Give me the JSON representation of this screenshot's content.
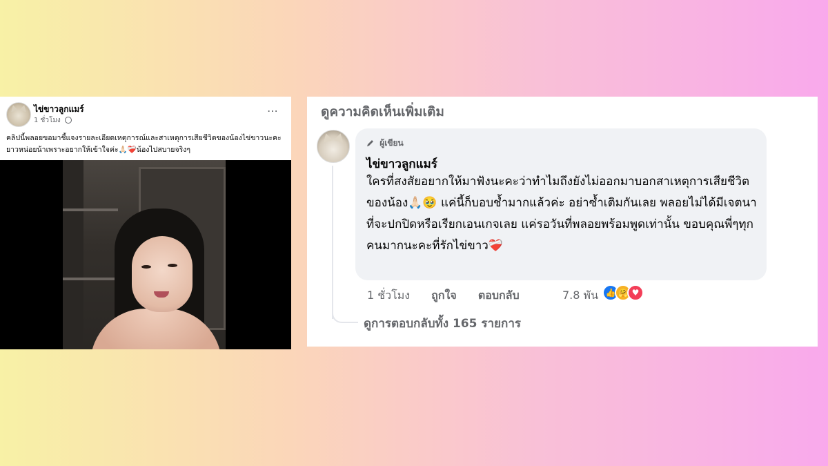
{
  "post": {
    "author": "ไข่ขาวลูกแมร์",
    "time": "1 ชั่วโมง",
    "more_icon": "⋯",
    "caption": "คลิปนี้พลอยขอมาชี้แจงรายละเอียดเหตุการณ์และสาเหตุการเสียชีวิตของน้องไข่ขาวนะคะ ยาวหน่อยน้าเพราะอยากให้เข้าใจค่ะ🙏🏻❤️‍🩹น้องไปสบายจริงๆ"
  },
  "comments": {
    "more_comments_label": "ดูความคิดเห็นเพิ่มเติม",
    "comment": {
      "badge": "ผู้เขียน",
      "author": "ไข่ขาวลูกแมร์",
      "text": "ใครที่สงสัยอยากให้มาฟังนะคะว่าทำไมถึงยังไม่ออกมาบอกสาเหตุการเสียชีวิตของน้อง🙏🏻🥹 แค่นี้ก็บอบช้ำมากแล้วค่ะ อย่าซ้ำเติมกันเลย พลอยไม่ได้มีเจตนาที่จะปกปิดหรือเรียกเอนเกจเลย แค่รอวันที่พลอยพร้อมพูดเท่านั้น ขอบคุณพี่ๆทุกคนมากนะคะที่รักไข่ขาว❤️‍🩹",
      "time": "1 ชั่วโมง",
      "like_label": "ถูกใจ",
      "reply_label": "ตอบกลับ",
      "reaction_count": "7.8 พัน",
      "reactions": [
        "like-icon",
        "care-icon",
        "love-icon"
      ]
    },
    "view_replies_label": "ดูการตอบกลับทั้ง 165 รายการ"
  },
  "colors": {
    "facebook_blue": "#1877f2",
    "secondary_text": "#65676b",
    "bubble_bg": "#f0f2f5"
  }
}
